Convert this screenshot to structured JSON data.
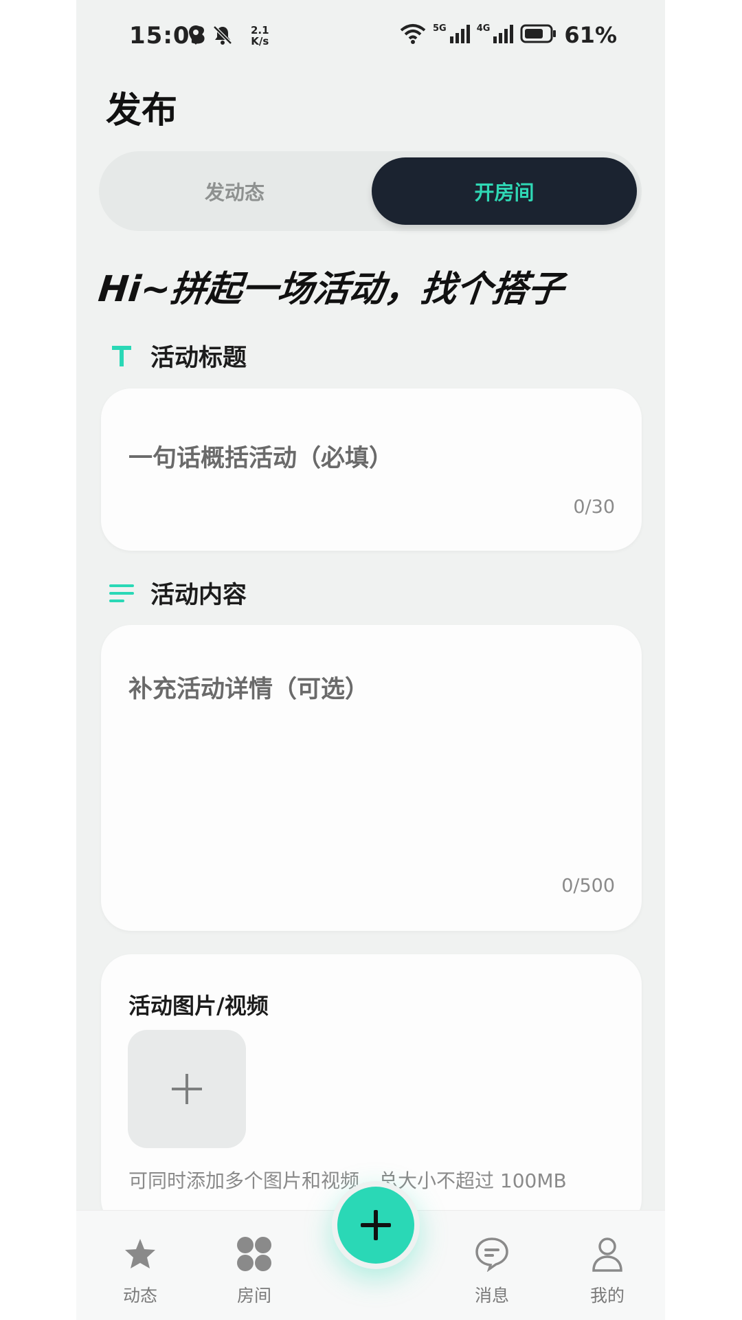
{
  "status_bar": {
    "time": "15:03",
    "speed_top": "2.1",
    "speed_bottom": "K/s",
    "net1": "5G",
    "net2": "4G",
    "battery": "61%"
  },
  "page": {
    "title": "发布"
  },
  "tabs": {
    "left": "发动态",
    "right": "开房间",
    "active": "开房间"
  },
  "headline": "Hi~拼起一场活动，找个搭子",
  "title_section": {
    "label": "活动标题",
    "placeholder": "一句话概括活动（必填）",
    "counter": "0/30"
  },
  "content_section": {
    "label": "活动内容",
    "placeholder": "补充活动详情（可选）",
    "counter": "0/500"
  },
  "media_section": {
    "label": "活动图片/视频",
    "hint": "可同时添加多个图片和视频，总大小不超过 100MB"
  },
  "bottom_nav": {
    "items": [
      {
        "label": "动态",
        "icon": "star-icon"
      },
      {
        "label": "房间",
        "icon": "clover-icon"
      },
      {
        "label": "消息",
        "icon": "chat-icon"
      },
      {
        "label": "我的",
        "icon": "person-icon"
      }
    ],
    "fab_icon": "plus-icon"
  },
  "colors": {
    "accent": "#2ad8b6",
    "dark": "#1b2330",
    "background": "#f0f2f1"
  }
}
